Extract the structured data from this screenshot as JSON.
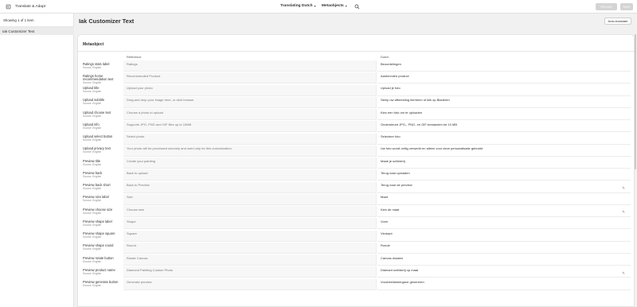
{
  "app": {
    "title": "Translate & Adapt"
  },
  "header": {
    "language_picker": "Translating Dutch",
    "resource_picker": "Metaobjects",
    "discard_label": "Discard",
    "save_label": "Save"
  },
  "sidebar": {
    "count": "Showing 1 of 1 item",
    "items": [
      {
        "label": "Iak Customizer Text"
      }
    ]
  },
  "page": {
    "title": "Iak Customizer Text",
    "auto_translate_label": "Auto-translate"
  },
  "card": {
    "title": "Metaobject"
  },
  "table": {
    "columns": {
      "reference": "Reference",
      "translation": "Dutch"
    },
    "rows": [
      {
        "label": "Ratings stats label",
        "source": "Source: English",
        "reference": "Ratings",
        "translation": "Beoordelingen"
      },
      {
        "label": "Ratings home recommendation text",
        "source": "Source: English",
        "reference": "Recommended Product",
        "translation": "Aanbevolen product"
      },
      {
        "label": "Upload title",
        "source": "Source: English",
        "reference": "Upload your photo",
        "translation": "Upload je foto"
      },
      {
        "label": "Upload subtitle",
        "source": "Source: English",
        "reference": "Drag and drop your image here, or click browse",
        "translation": "Sleep uw afbeelding hierheen of klik op Bladeren"
      },
      {
        "label": "Upload choose text",
        "source": "Source: English",
        "reference": "Choose a photo to upload",
        "translation": "Kies een foto om te uploaden"
      },
      {
        "label": "Upload info",
        "source": "Source: English",
        "reference": "Supports JPG, PNG and GIF files up to 10MB",
        "translation": "Ondersteunt JPG-, PNG- en GIF-bestanden tot 10 MB"
      },
      {
        "label": "Upload select button",
        "source": "Source: English",
        "reference": "Select photo",
        "translation": "Selecteer foto"
      },
      {
        "label": "Upload privacy text",
        "source": "Source: English",
        "reference": "Your photo will be processed securely and used only for this customization",
        "translation": "Uw foto wordt veilig verwerkt en alleen voor deze personalisatie gebruikt"
      },
      {
        "label": "Preview title",
        "source": "Source: English",
        "reference": "Create your painting",
        "translation": "Maak je schilderij"
      },
      {
        "label": "Preview back",
        "source": "Source: English",
        "reference": "Back to upload",
        "translation": "Terug naar uploaden"
      },
      {
        "label": "Preview back short",
        "source": "Source: English",
        "reference": "Back to Preview",
        "translation": "Terug naar de preview"
      },
      {
        "label": "Preview size label",
        "source": "Source: English",
        "reference": "Size",
        "translation": "Maat"
      },
      {
        "label": "Preview choose size",
        "source": "Source: English",
        "reference": "Choose size",
        "translation": "Kies de maat"
      },
      {
        "label": "Preview shape label",
        "source": "Source: English",
        "reference": "Shape",
        "translation": "Vorm"
      },
      {
        "label": "Preview shape square",
        "source": "Source: English",
        "reference": "Square",
        "translation": "Vierkant"
      },
      {
        "label": "Preview shape round",
        "source": "Source: English",
        "reference": "Round",
        "translation": "Ronde"
      },
      {
        "label": "Preview rotate button",
        "source": "Source: English",
        "reference": "Rotate Canvas",
        "translation": "Canvas draaien"
      },
      {
        "label": "Preview product name",
        "source": "Source: English",
        "reference": "Diamond Painting Custom Photo",
        "translation": "Diamant schilderij op maat"
      },
      {
        "label": "Preview generate button",
        "source": "Source: English",
        "reference": "Generate preview",
        "translation": "Voorbeeldweergave genereren"
      }
    ]
  },
  "icons": {
    "back": "back-icon",
    "search": "search-icon",
    "edit": "pencil-icon"
  }
}
